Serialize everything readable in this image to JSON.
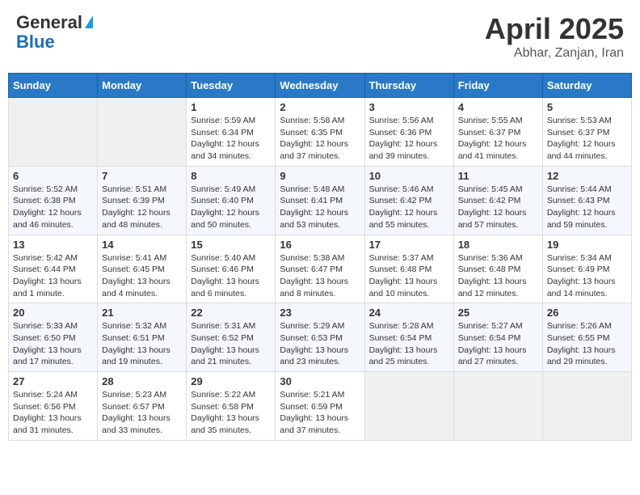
{
  "header": {
    "logo_line1": "General",
    "logo_line2": "Blue",
    "month_year": "April 2025",
    "location": "Abhar, Zanjan, Iran"
  },
  "days_of_week": [
    "Sunday",
    "Monday",
    "Tuesday",
    "Wednesday",
    "Thursday",
    "Friday",
    "Saturday"
  ],
  "weeks": [
    [
      {
        "day": "",
        "sunrise": "",
        "sunset": "",
        "daylight": "",
        "empty": true
      },
      {
        "day": "",
        "sunrise": "",
        "sunset": "",
        "daylight": "",
        "empty": true
      },
      {
        "day": "1",
        "sunrise": "Sunrise: 5:59 AM",
        "sunset": "Sunset: 6:34 PM",
        "daylight": "Daylight: 12 hours and 34 minutes."
      },
      {
        "day": "2",
        "sunrise": "Sunrise: 5:58 AM",
        "sunset": "Sunset: 6:35 PM",
        "daylight": "Daylight: 12 hours and 37 minutes."
      },
      {
        "day": "3",
        "sunrise": "Sunrise: 5:56 AM",
        "sunset": "Sunset: 6:36 PM",
        "daylight": "Daylight: 12 hours and 39 minutes."
      },
      {
        "day": "4",
        "sunrise": "Sunrise: 5:55 AM",
        "sunset": "Sunset: 6:37 PM",
        "daylight": "Daylight: 12 hours and 41 minutes."
      },
      {
        "day": "5",
        "sunrise": "Sunrise: 5:53 AM",
        "sunset": "Sunset: 6:37 PM",
        "daylight": "Daylight: 12 hours and 44 minutes."
      }
    ],
    [
      {
        "day": "6",
        "sunrise": "Sunrise: 5:52 AM",
        "sunset": "Sunset: 6:38 PM",
        "daylight": "Daylight: 12 hours and 46 minutes."
      },
      {
        "day": "7",
        "sunrise": "Sunrise: 5:51 AM",
        "sunset": "Sunset: 6:39 PM",
        "daylight": "Daylight: 12 hours and 48 minutes."
      },
      {
        "day": "8",
        "sunrise": "Sunrise: 5:49 AM",
        "sunset": "Sunset: 6:40 PM",
        "daylight": "Daylight: 12 hours and 50 minutes."
      },
      {
        "day": "9",
        "sunrise": "Sunrise: 5:48 AM",
        "sunset": "Sunset: 6:41 PM",
        "daylight": "Daylight: 12 hours and 53 minutes."
      },
      {
        "day": "10",
        "sunrise": "Sunrise: 5:46 AM",
        "sunset": "Sunset: 6:42 PM",
        "daylight": "Daylight: 12 hours and 55 minutes."
      },
      {
        "day": "11",
        "sunrise": "Sunrise: 5:45 AM",
        "sunset": "Sunset: 6:42 PM",
        "daylight": "Daylight: 12 hours and 57 minutes."
      },
      {
        "day": "12",
        "sunrise": "Sunrise: 5:44 AM",
        "sunset": "Sunset: 6:43 PM",
        "daylight": "Daylight: 12 hours and 59 minutes."
      }
    ],
    [
      {
        "day": "13",
        "sunrise": "Sunrise: 5:42 AM",
        "sunset": "Sunset: 6:44 PM",
        "daylight": "Daylight: 13 hours and 1 minute."
      },
      {
        "day": "14",
        "sunrise": "Sunrise: 5:41 AM",
        "sunset": "Sunset: 6:45 PM",
        "daylight": "Daylight: 13 hours and 4 minutes."
      },
      {
        "day": "15",
        "sunrise": "Sunrise: 5:40 AM",
        "sunset": "Sunset: 6:46 PM",
        "daylight": "Daylight: 13 hours and 6 minutes."
      },
      {
        "day": "16",
        "sunrise": "Sunrise: 5:38 AM",
        "sunset": "Sunset: 6:47 PM",
        "daylight": "Daylight: 13 hours and 8 minutes."
      },
      {
        "day": "17",
        "sunrise": "Sunrise: 5:37 AM",
        "sunset": "Sunset: 6:48 PM",
        "daylight": "Daylight: 13 hours and 10 minutes."
      },
      {
        "day": "18",
        "sunrise": "Sunrise: 5:36 AM",
        "sunset": "Sunset: 6:48 PM",
        "daylight": "Daylight: 13 hours and 12 minutes."
      },
      {
        "day": "19",
        "sunrise": "Sunrise: 5:34 AM",
        "sunset": "Sunset: 6:49 PM",
        "daylight": "Daylight: 13 hours and 14 minutes."
      }
    ],
    [
      {
        "day": "20",
        "sunrise": "Sunrise: 5:33 AM",
        "sunset": "Sunset: 6:50 PM",
        "daylight": "Daylight: 13 hours and 17 minutes."
      },
      {
        "day": "21",
        "sunrise": "Sunrise: 5:32 AM",
        "sunset": "Sunset: 6:51 PM",
        "daylight": "Daylight: 13 hours and 19 minutes."
      },
      {
        "day": "22",
        "sunrise": "Sunrise: 5:31 AM",
        "sunset": "Sunset: 6:52 PM",
        "daylight": "Daylight: 13 hours and 21 minutes."
      },
      {
        "day": "23",
        "sunrise": "Sunrise: 5:29 AM",
        "sunset": "Sunset: 6:53 PM",
        "daylight": "Daylight: 13 hours and 23 minutes."
      },
      {
        "day": "24",
        "sunrise": "Sunrise: 5:28 AM",
        "sunset": "Sunset: 6:54 PM",
        "daylight": "Daylight: 13 hours and 25 minutes."
      },
      {
        "day": "25",
        "sunrise": "Sunrise: 5:27 AM",
        "sunset": "Sunset: 6:54 PM",
        "daylight": "Daylight: 13 hours and 27 minutes."
      },
      {
        "day": "26",
        "sunrise": "Sunrise: 5:26 AM",
        "sunset": "Sunset: 6:55 PM",
        "daylight": "Daylight: 13 hours and 29 minutes."
      }
    ],
    [
      {
        "day": "27",
        "sunrise": "Sunrise: 5:24 AM",
        "sunset": "Sunset: 6:56 PM",
        "daylight": "Daylight: 13 hours and 31 minutes."
      },
      {
        "day": "28",
        "sunrise": "Sunrise: 5:23 AM",
        "sunset": "Sunset: 6:57 PM",
        "daylight": "Daylight: 13 hours and 33 minutes."
      },
      {
        "day": "29",
        "sunrise": "Sunrise: 5:22 AM",
        "sunset": "Sunset: 6:58 PM",
        "daylight": "Daylight: 13 hours and 35 minutes."
      },
      {
        "day": "30",
        "sunrise": "Sunrise: 5:21 AM",
        "sunset": "Sunset: 6:59 PM",
        "daylight": "Daylight: 13 hours and 37 minutes."
      },
      {
        "day": "",
        "sunrise": "",
        "sunset": "",
        "daylight": "",
        "empty": true
      },
      {
        "day": "",
        "sunrise": "",
        "sunset": "",
        "daylight": "",
        "empty": true
      },
      {
        "day": "",
        "sunrise": "",
        "sunset": "",
        "daylight": "",
        "empty": true
      }
    ]
  ]
}
